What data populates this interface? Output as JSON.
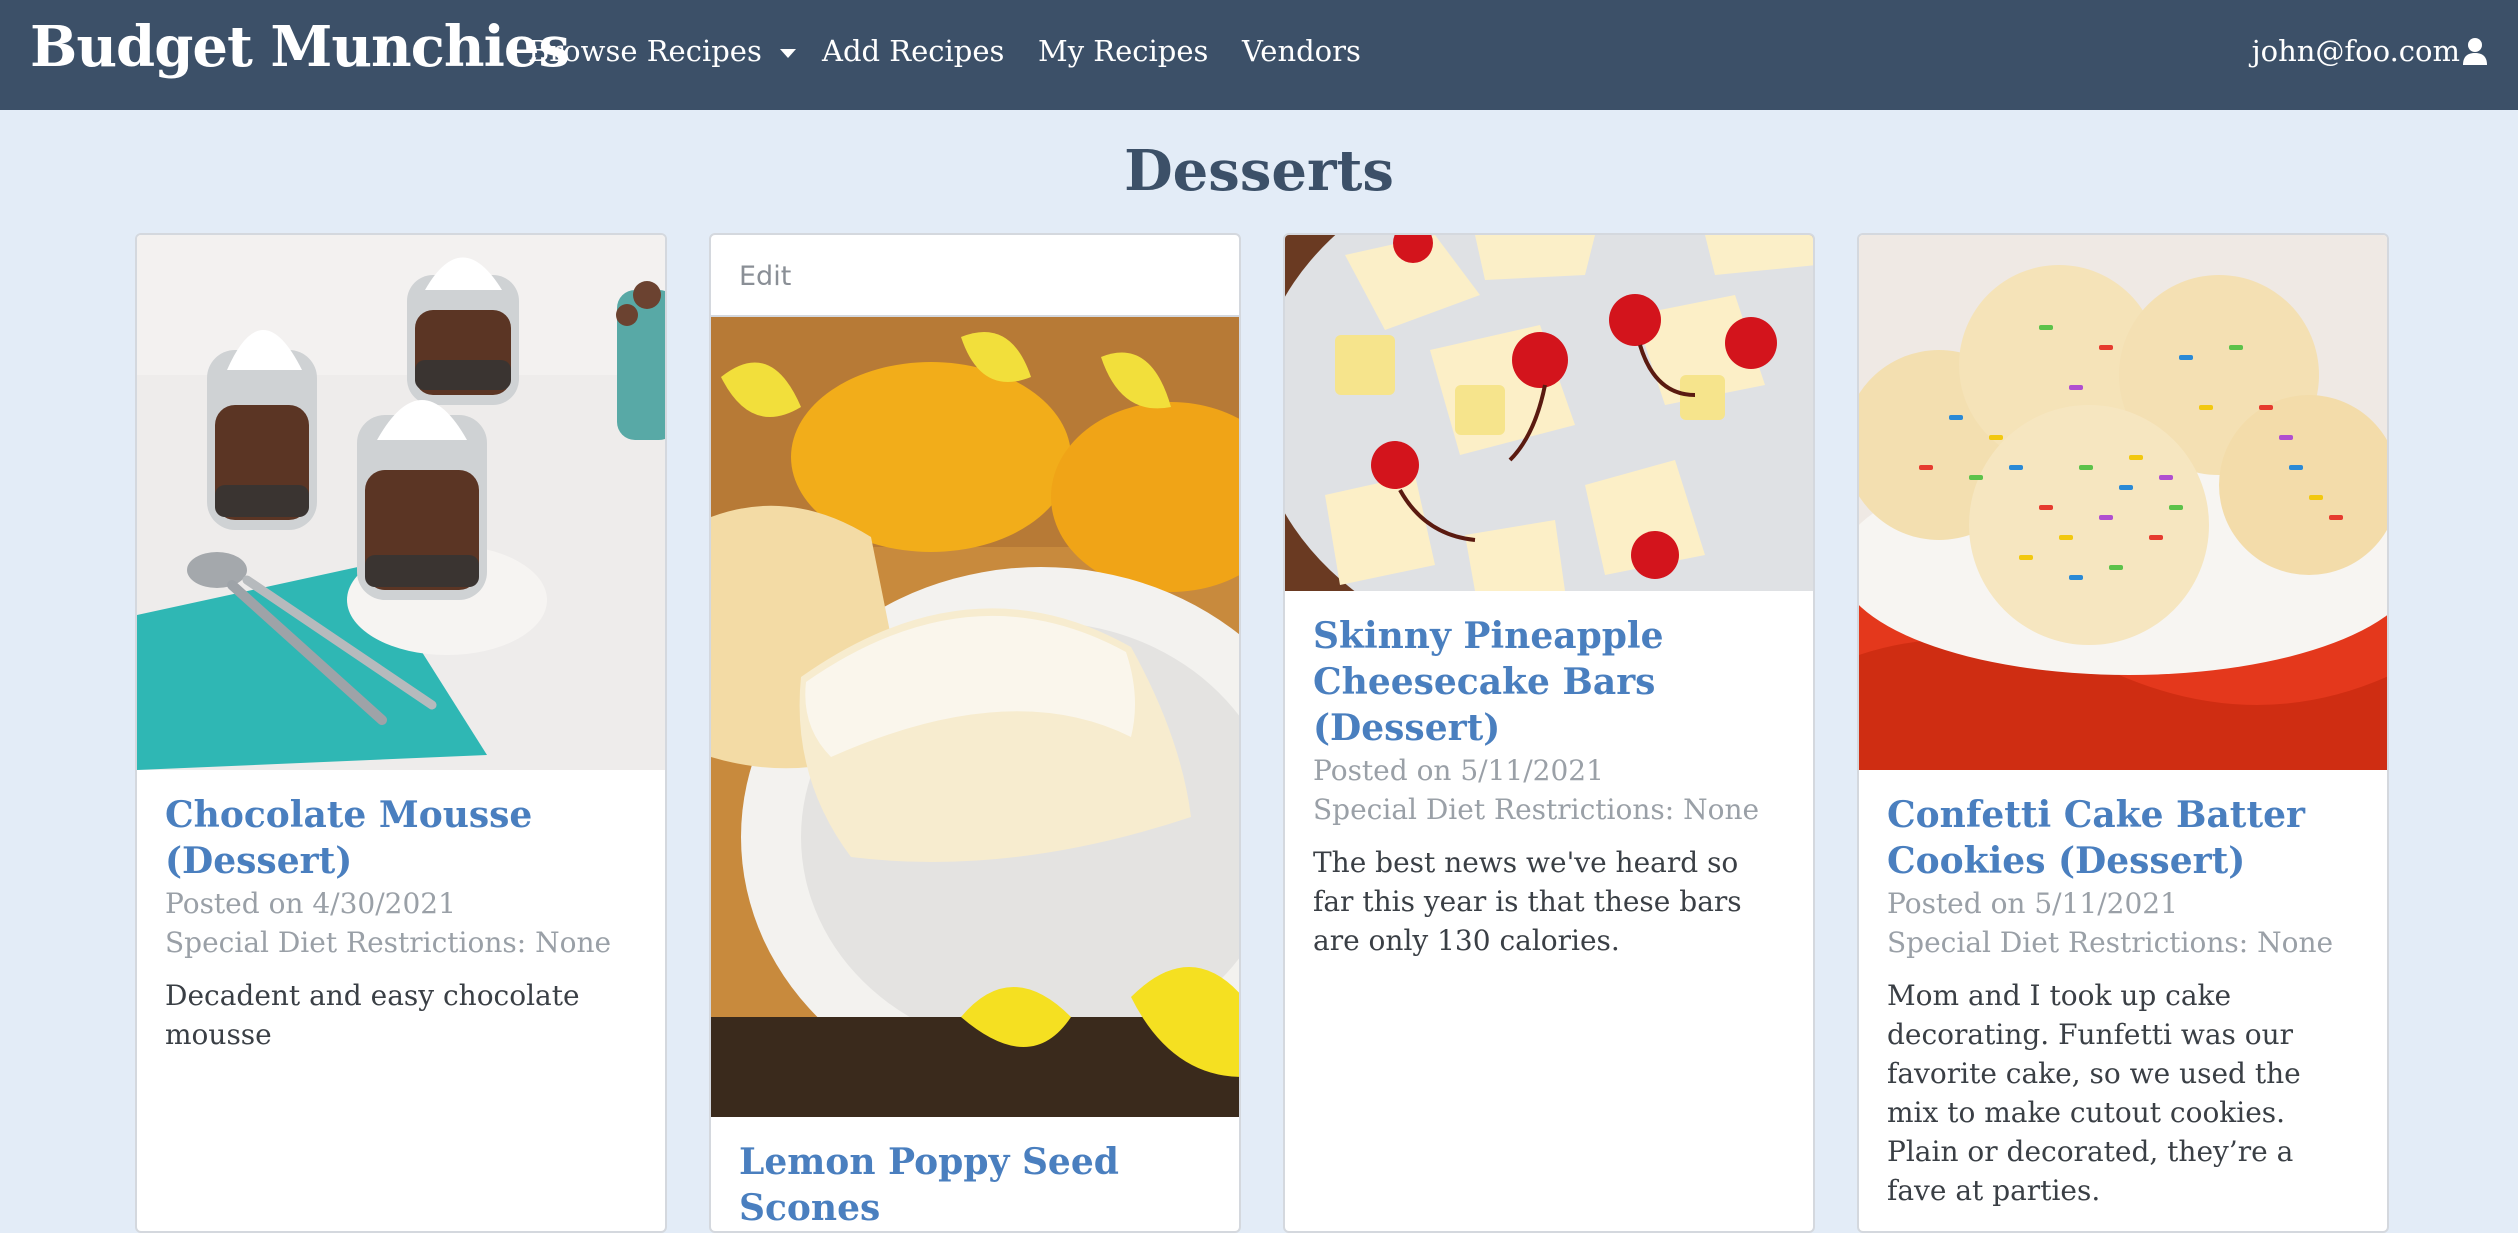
{
  "navbar": {
    "brand": "Budget Munchies",
    "items": [
      {
        "label": "Browse Recipes"
      },
      {
        "label": "Add Recipes"
      },
      {
        "label": "My Recipes"
      },
      {
        "label": "Vendors"
      }
    ],
    "user_email": "john@foo.com"
  },
  "page": {
    "title": "Desserts"
  },
  "cards": [
    {
      "title": "Chocolate Mousse (Dessert)",
      "posted": "Posted on 4/30/2021",
      "diet": "Special Diet Restrictions: None",
      "description": "Decadent and easy chocolate mousse"
    },
    {
      "header": "Edit",
      "title": "Lemon Poppy Seed Scones"
    },
    {
      "title": "Skinny Pineapple Cheesecake Bars (Dessert)",
      "posted": "Posted on 5/11/2021",
      "diet": "Special Diet Restrictions: None",
      "description": "The best news we've heard so far this year is that these bars are only 130 calories."
    },
    {
      "title": "Confetti Cake Batter Cookies (Dessert)",
      "posted": "Posted on 5/11/2021",
      "diet": "Special Diet Restrictions: None",
      "description": "Mom and I took up cake decorating. Funfetti was our favorite cake, so we used the mix to make cutout cookies. Plain or decorated, they’re a fave at parties."
    }
  ],
  "colors": {
    "navbar_bg": "#3c5068",
    "page_bg": "#e3ecf7",
    "title_blue": "#4a7fbf"
  }
}
